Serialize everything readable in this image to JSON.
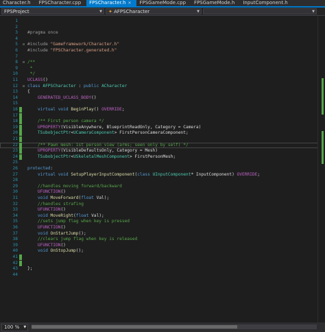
{
  "tabs": [
    {
      "label": "Character.h",
      "active": false
    },
    {
      "label": "FPSCharacter.cpp",
      "active": false
    },
    {
      "label": "FPSCharacter.h",
      "active": true
    },
    {
      "label": "FPSGameMode.cpp",
      "active": false
    },
    {
      "label": "FPSGameMode.h",
      "active": false
    },
    {
      "label": "InputComponent.h",
      "active": false
    }
  ],
  "navbar": {
    "project": "FPSProject",
    "scope": "AFPSCharacter"
  },
  "colors": {
    "keyword": "#569cd6",
    "type": "#4ec9b0",
    "string": "#d69d85",
    "comment": "#57a64a",
    "macro": "#bd63c5",
    "text": "#dcdcdc",
    "preproc": "#9b9b9b",
    "function": "#dcdcaa",
    "accent": "#007acc"
  },
  "lines": [
    {
      "n": "1",
      "green": false,
      "fold": "",
      "tokens": []
    },
    {
      "n": "2",
      "green": false,
      "fold": "",
      "tokens": []
    },
    {
      "n": "3",
      "green": false,
      "fold": "",
      "tokens": [
        [
          "preproc",
          "#pragma once"
        ]
      ]
    },
    {
      "n": "4",
      "green": false,
      "fold": "",
      "tokens": []
    },
    {
      "n": "5",
      "green": false,
      "fold": "⊟",
      "tokens": [
        [
          "preproc",
          "#include "
        ],
        [
          "string",
          "\"GameFramework/Character.h\""
        ]
      ]
    },
    {
      "n": "6",
      "green": false,
      "fold": "",
      "tokens": [
        [
          "preproc",
          "#include "
        ],
        [
          "string",
          "\"FPSCharacter.generated.h\""
        ]
      ]
    },
    {
      "n": "7",
      "green": false,
      "fold": "",
      "tokens": []
    },
    {
      "n": "8",
      "green": false,
      "fold": "⊟",
      "tokens": [
        [
          "comment",
          "/**"
        ]
      ]
    },
    {
      "n": "9",
      "green": false,
      "fold": "",
      "tokens": [
        [
          "comment",
          " *"
        ]
      ]
    },
    {
      "n": "10",
      "green": false,
      "fold": "",
      "tokens": [
        [
          "comment",
          " */"
        ]
      ]
    },
    {
      "n": "11",
      "green": false,
      "fold": "",
      "tokens": [
        [
          "macro",
          "UCLASS"
        ],
        [
          "text",
          "()"
        ]
      ]
    },
    {
      "n": "12",
      "green": false,
      "fold": "⊟",
      "tokens": [
        [
          "keyword",
          "class "
        ],
        [
          "type",
          "AFPSCharacter"
        ],
        [
          "text",
          " : "
        ],
        [
          "keyword",
          "public "
        ],
        [
          "type",
          "ACharacter"
        ]
      ]
    },
    {
      "n": "13",
      "green": false,
      "fold": "",
      "tokens": [
        [
          "text",
          "{"
        ]
      ]
    },
    {
      "n": "14",
      "green": false,
      "fold": "",
      "tokens": [
        [
          "macro",
          "    GENERATED_UCLASS_BODY"
        ],
        [
          "text",
          "()"
        ]
      ]
    },
    {
      "n": "15",
      "green": false,
      "fold": "",
      "tokens": []
    },
    {
      "n": "16",
      "green": true,
      "fold": "",
      "tokens": [
        [
          "keyword",
          "    virtual void "
        ],
        [
          "function",
          "BeginPlay"
        ],
        [
          "text",
          "() "
        ],
        [
          "macro",
          "OVERRIDE"
        ],
        [
          "text",
          ";"
        ]
      ]
    },
    {
      "n": "17",
      "green": true,
      "fold": "",
      "tokens": []
    },
    {
      "n": "18",
      "green": true,
      "fold": "",
      "tokens": [
        [
          "comment",
          "    /** First person camera */"
        ]
      ]
    },
    {
      "n": "19",
      "green": true,
      "fold": "",
      "tokens": [
        [
          "macro",
          "    UPROPERTY"
        ],
        [
          "text",
          "(VisibleAnywhere, BlueprintReadOnly, Category = Camera)"
        ]
      ]
    },
    {
      "n": "20",
      "green": true,
      "fold": "",
      "tokens": [
        [
          "type",
          "    TSubobjectPtr"
        ],
        [
          "text",
          "<"
        ],
        [
          "type",
          "UCameraComponent"
        ],
        [
          "text",
          "> FirstPersonCameraComponent;"
        ]
      ]
    },
    {
      "n": "21",
      "green": true,
      "fold": "",
      "tokens": []
    },
    {
      "n": "22",
      "green": true,
      "fold": "",
      "current": true,
      "tokens": [
        [
          "comment",
          "    /** Pawn mesh: 1st person view (arms; seen only by self) */"
        ]
      ]
    },
    {
      "n": "23",
      "green": true,
      "fold": "",
      "tokens": [
        [
          "macro",
          "    UPROPERTY"
        ],
        [
          "text",
          "(VisibleDefaultsOnly, Category = Mesh)"
        ]
      ]
    },
    {
      "n": "24",
      "green": true,
      "fold": "",
      "tokens": [
        [
          "type",
          "    TSubobjectPtr"
        ],
        [
          "text",
          "<"
        ],
        [
          "type",
          "USkeletalMeshComponent"
        ],
        [
          "text",
          "> FirstPersonMesh;"
        ]
      ]
    },
    {
      "n": "25",
      "green": false,
      "fold": "",
      "tokens": []
    },
    {
      "n": "26",
      "green": false,
      "fold": "",
      "tokens": [
        [
          "keyword",
          "protected"
        ],
        [
          "text",
          ":"
        ]
      ]
    },
    {
      "n": "27",
      "green": false,
      "fold": "",
      "tokens": [
        [
          "keyword",
          "    virtual void "
        ],
        [
          "function",
          "SetupPlayerInputComponent"
        ],
        [
          "text",
          "("
        ],
        [
          "keyword",
          "class "
        ],
        [
          "type",
          "UInputComponent"
        ],
        [
          "text",
          "* InputComponent) "
        ],
        [
          "macro",
          "OVERRIDE"
        ],
        [
          "text",
          ";"
        ]
      ]
    },
    {
      "n": "28",
      "green": false,
      "fold": "",
      "tokens": []
    },
    {
      "n": "29",
      "green": false,
      "fold": "",
      "tokens": [
        [
          "comment",
          "    //handles moving forward/backward"
        ]
      ]
    },
    {
      "n": "30",
      "green": false,
      "fold": "",
      "tokens": [
        [
          "macro",
          "    UFUNCTION"
        ],
        [
          "text",
          "()"
        ]
      ]
    },
    {
      "n": "31",
      "green": false,
      "fold": "",
      "tokens": [
        [
          "keyword",
          "    void "
        ],
        [
          "function",
          "MoveForward"
        ],
        [
          "text",
          "("
        ],
        [
          "keyword",
          "float "
        ],
        [
          "text",
          "Val);"
        ]
      ]
    },
    {
      "n": "32",
      "green": false,
      "fold": "",
      "tokens": [
        [
          "comment",
          "    //handles strafing"
        ]
      ]
    },
    {
      "n": "33",
      "green": false,
      "fold": "",
      "tokens": [
        [
          "macro",
          "    UFUNCTION"
        ],
        [
          "text",
          "()"
        ]
      ]
    },
    {
      "n": "34",
      "green": false,
      "fold": "",
      "tokens": [
        [
          "keyword",
          "    void "
        ],
        [
          "function",
          "MoveRight"
        ],
        [
          "text",
          "("
        ],
        [
          "keyword",
          "float "
        ],
        [
          "text",
          "Val);"
        ]
      ]
    },
    {
      "n": "35",
      "green": false,
      "fold": "",
      "tokens": [
        [
          "comment",
          "    //sets jump flag when key is pressed"
        ]
      ]
    },
    {
      "n": "36",
      "green": false,
      "fold": "",
      "tokens": [
        [
          "macro",
          "    UFUNCTION"
        ],
        [
          "text",
          "()"
        ]
      ]
    },
    {
      "n": "37",
      "green": false,
      "fold": "",
      "tokens": [
        [
          "keyword",
          "    void "
        ],
        [
          "function",
          "OnStartJump"
        ],
        [
          "text",
          "();"
        ]
      ]
    },
    {
      "n": "38",
      "green": false,
      "fold": "",
      "tokens": [
        [
          "comment",
          "    //clears jump flag when key is released"
        ]
      ]
    },
    {
      "n": "39",
      "green": false,
      "fold": "",
      "tokens": [
        [
          "macro",
          "    UFUNCTION"
        ],
        [
          "text",
          "()"
        ]
      ]
    },
    {
      "n": "40",
      "green": false,
      "fold": "",
      "tokens": [
        [
          "keyword",
          "    void "
        ],
        [
          "function",
          "OnStopJump"
        ],
        [
          "text",
          "();"
        ]
      ]
    },
    {
      "n": "41",
      "green": true,
      "fold": "",
      "tokens": []
    },
    {
      "n": "42",
      "green": true,
      "fold": "",
      "tokens": []
    },
    {
      "n": "43",
      "green": false,
      "fold": "",
      "tokens": [
        [
          "text",
          "};"
        ]
      ]
    },
    {
      "n": "44",
      "green": false,
      "fold": "",
      "tokens": []
    }
  ],
  "statusbar": {
    "zoom": "100 %"
  }
}
